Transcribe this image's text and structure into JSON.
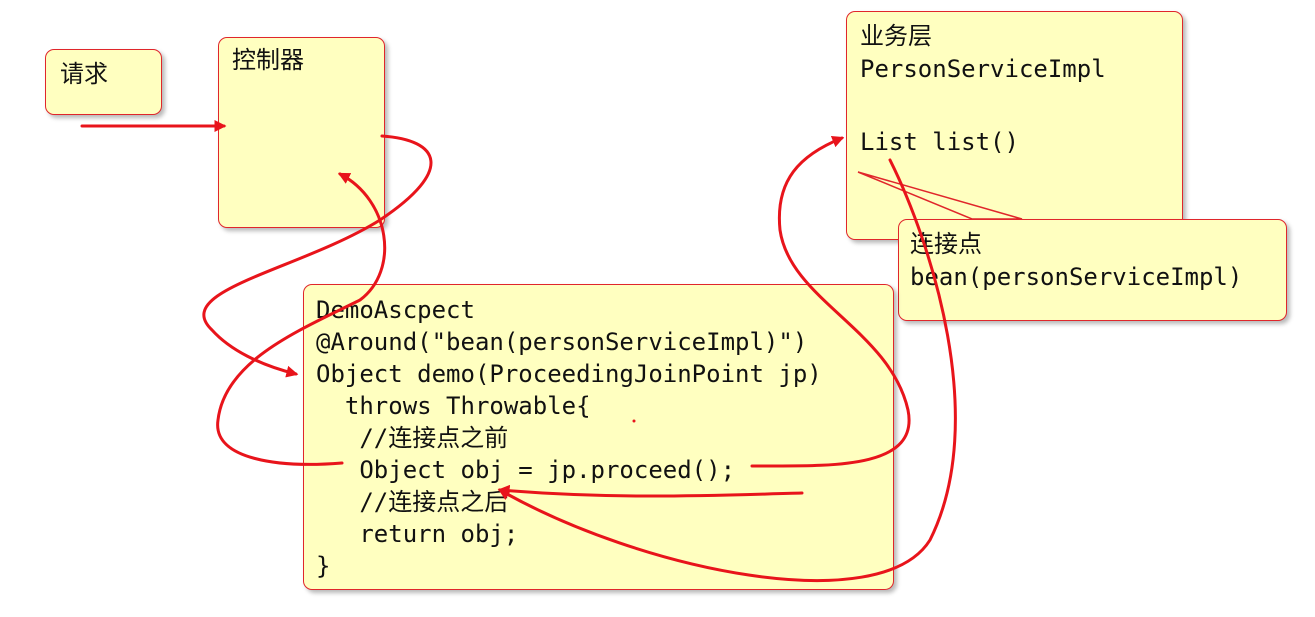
{
  "request": {
    "label": "请求"
  },
  "controller": {
    "label": "控制器"
  },
  "service": {
    "layer_label": "业务层",
    "class_name": "PersonServiceImpl",
    "method": "List list()"
  },
  "joinpoint": {
    "label": "连接点",
    "expression": "bean(personServiceImpl)"
  },
  "aspect": {
    "lines": [
      "DemoAscpect",
      "@Around(\"bean(personServiceImpl)\")",
      "Object demo(ProceedingJoinPoint jp)",
      "  throws Throwable{",
      "   //连接点之前",
      "   Object obj = jp.proceed();",
      "   //连接点之后",
      "   return obj;",
      "}"
    ]
  },
  "colors": {
    "box_fill": "#ffffc0",
    "border": "#e0262b",
    "arrow": "#e8141b"
  }
}
